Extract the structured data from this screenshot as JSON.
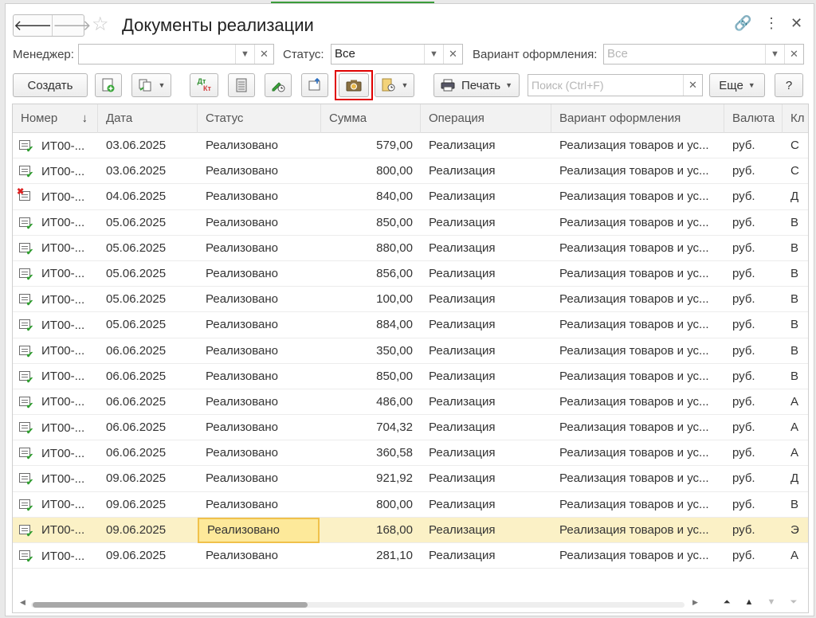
{
  "window": {
    "title": "Документы реализации",
    "back_glyph": "🡐",
    "forward_glyph": "🡒",
    "favorite_glyph": "☆",
    "link_glyph": "🔗",
    "more_glyph": "⋮",
    "close_glyph": "✕"
  },
  "filters": {
    "manager_label": "Менеджер:",
    "manager_value": "",
    "status_label": "Статус:",
    "status_value": "Все",
    "variant_label": "Вариант оформления:",
    "variant_value": "Все"
  },
  "toolbar": {
    "create_label": "Создать",
    "print_label": "Печать",
    "search_placeholder": "Поиск (Ctrl+F)",
    "more_label": "Еще",
    "help_label": "?",
    "dtkt_top": "Дт",
    "dtkt_bottom": "Кт"
  },
  "table": {
    "columns": [
      "Номер",
      "Дата",
      "Статус",
      "Сумма",
      "Операция",
      "Вариант оформления",
      "Валюта",
      "Кл"
    ],
    "sort_glyph": "↓",
    "rows": [
      {
        "num": "ИТ00-...",
        "date": "03.06.2025",
        "status": "Реализовано",
        "sum": "579,00",
        "op": "Реализация",
        "variant": "Реализация товаров и ус...",
        "cur": "руб.",
        "cl": "С",
        "mark": "ok"
      },
      {
        "num": "ИТ00-...",
        "date": "03.06.2025",
        "status": "Реализовано",
        "sum": "800,00",
        "op": "Реализация",
        "variant": "Реализация товаров и ус...",
        "cur": "руб.",
        "cl": "С",
        "mark": "ok"
      },
      {
        "num": "ИТ00-...",
        "date": "04.06.2025",
        "status": "Реализовано",
        "sum": "840,00",
        "op": "Реализация",
        "variant": "Реализация товаров и ус...",
        "cur": "руб.",
        "cl": "Д",
        "mark": "del"
      },
      {
        "num": "ИТ00-...",
        "date": "05.06.2025",
        "status": "Реализовано",
        "sum": "850,00",
        "op": "Реализация",
        "variant": "Реализация товаров и ус...",
        "cur": "руб.",
        "cl": "В",
        "mark": "ok"
      },
      {
        "num": "ИТ00-...",
        "date": "05.06.2025",
        "status": "Реализовано",
        "sum": "880,00",
        "op": "Реализация",
        "variant": "Реализация товаров и ус...",
        "cur": "руб.",
        "cl": "В",
        "mark": "ok"
      },
      {
        "num": "ИТ00-...",
        "date": "05.06.2025",
        "status": "Реализовано",
        "sum": "856,00",
        "op": "Реализация",
        "variant": "Реализация товаров и ус...",
        "cur": "руб.",
        "cl": "В",
        "mark": "ok"
      },
      {
        "num": "ИТ00-...",
        "date": "05.06.2025",
        "status": "Реализовано",
        "sum": "100,00",
        "op": "Реализация",
        "variant": "Реализация товаров и ус...",
        "cur": "руб.",
        "cl": "В",
        "mark": "ok"
      },
      {
        "num": "ИТ00-...",
        "date": "05.06.2025",
        "status": "Реализовано",
        "sum": "884,00",
        "op": "Реализация",
        "variant": "Реализация товаров и ус...",
        "cur": "руб.",
        "cl": "В",
        "mark": "ok"
      },
      {
        "num": "ИТ00-...",
        "date": "06.06.2025",
        "status": "Реализовано",
        "sum": "350,00",
        "op": "Реализация",
        "variant": "Реализация товаров и ус...",
        "cur": "руб.",
        "cl": "В",
        "mark": "ok"
      },
      {
        "num": "ИТ00-...",
        "date": "06.06.2025",
        "status": "Реализовано",
        "sum": "850,00",
        "op": "Реализация",
        "variant": "Реализация товаров и ус...",
        "cur": "руб.",
        "cl": "В",
        "mark": "ok"
      },
      {
        "num": "ИТ00-...",
        "date": "06.06.2025",
        "status": "Реализовано",
        "sum": "486,00",
        "op": "Реализация",
        "variant": "Реализация товаров и ус...",
        "cur": "руб.",
        "cl": "А",
        "mark": "ok"
      },
      {
        "num": "ИТ00-...",
        "date": "06.06.2025",
        "status": "Реализовано",
        "sum": "704,32",
        "op": "Реализация",
        "variant": "Реализация товаров и ус...",
        "cur": "руб.",
        "cl": "А",
        "mark": "ok"
      },
      {
        "num": "ИТ00-...",
        "date": "06.06.2025",
        "status": "Реализовано",
        "sum": "360,58",
        "op": "Реализация",
        "variant": "Реализация товаров и ус...",
        "cur": "руб.",
        "cl": "А",
        "mark": "ok"
      },
      {
        "num": "ИТ00-...",
        "date": "09.06.2025",
        "status": "Реализовано",
        "sum": "921,92",
        "op": "Реализация",
        "variant": "Реализация товаров и ус...",
        "cur": "руб.",
        "cl": "Д",
        "mark": "ok"
      },
      {
        "num": "ИТ00-...",
        "date": "09.06.2025",
        "status": "Реализовано",
        "sum": "800,00",
        "op": "Реализация",
        "variant": "Реализация товаров и ус...",
        "cur": "руб.",
        "cl": "В",
        "mark": "ok"
      },
      {
        "num": "ИТ00-...",
        "date": "09.06.2025",
        "status": "Реализовано",
        "sum": "168,00",
        "op": "Реализация",
        "variant": "Реализация товаров и ус...",
        "cur": "руб.",
        "cl": "Э",
        "mark": "ok",
        "selected": true
      },
      {
        "num": "ИТ00-...",
        "date": "09.06.2025",
        "status": "Реализовано",
        "sum": "281,10",
        "op": "Реализация",
        "variant": "Реализация товаров и ус...",
        "cur": "руб.",
        "cl": "А",
        "mark": "ok"
      }
    ]
  },
  "colors": {
    "selected_row": "#fbf1c6",
    "current_cell": "#fde99a",
    "highlight_border": "#e00000"
  }
}
